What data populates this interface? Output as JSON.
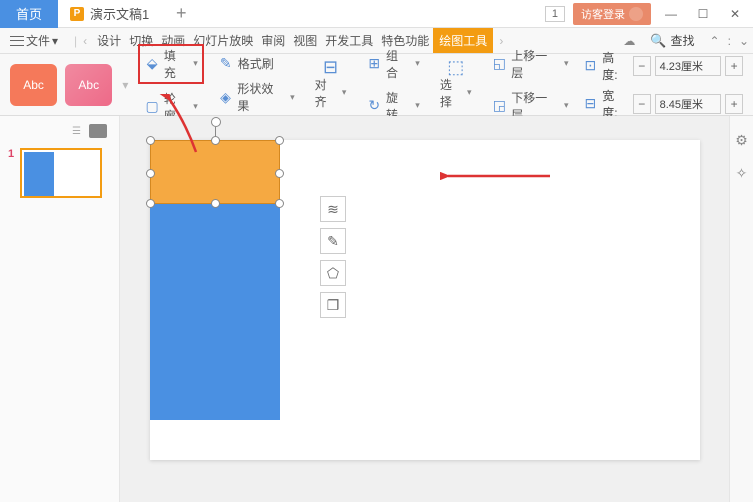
{
  "titlebar": {
    "home_tab": "首页",
    "doc_tab": "演示文稿1",
    "doc_icon_label": "P",
    "counter": "1",
    "login_label": "访客登录"
  },
  "menubar": {
    "file_label": "文件",
    "tabs": [
      "设计",
      "切换",
      "动画",
      "幻灯片放映",
      "审阅",
      "视图",
      "开发工具",
      "特色功能",
      "绘图工具"
    ],
    "search_label": "查找"
  },
  "ribbon": {
    "style_label": "Abc",
    "fill_label": "填充",
    "outline_label": "轮廓",
    "format_painter_label": "格式刷",
    "shape_effects_label": "形状效果",
    "align_label": "对齐",
    "group_label": "组合",
    "rotate_label": "旋转",
    "select_label": "选择",
    "bring_forward_label": "上移一层",
    "send_backward_label": "下移一层",
    "height_label": "高度:",
    "width_label": "宽度:",
    "height_value": "4.23厘米",
    "width_value": "8.45厘米"
  },
  "sidepanel": {
    "slide_number": "1"
  }
}
